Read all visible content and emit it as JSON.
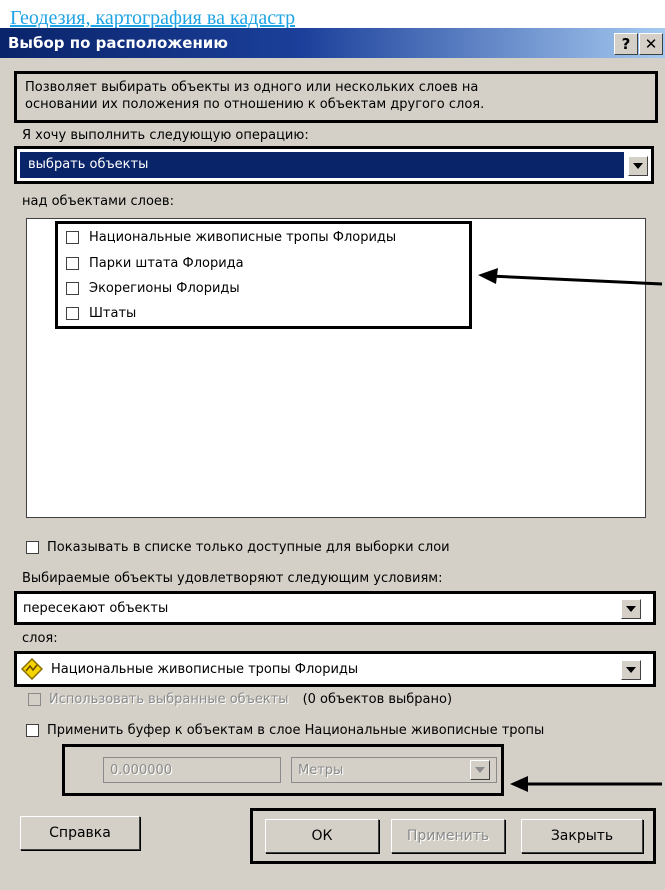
{
  "page_header": {
    "link_text": "Геодезия, картография ва кадастр"
  },
  "window": {
    "title": "Выбор по расположению",
    "help_glyph": "?",
    "close_glyph": "✕"
  },
  "description": {
    "line1": "Позволяет выбирать объекты из одного или нескольких слоев на",
    "line2": "основании их положения по отношению к объектам другого слоя."
  },
  "operation": {
    "label": "Я хочу выполнить следующую операцию:",
    "selected": "выбрать объекты"
  },
  "layers": {
    "label": "над объектами слоев:",
    "items": [
      {
        "label": "Национальные живописные тропы Флориды",
        "checked": false
      },
      {
        "label": "Парки штата Флорида",
        "checked": false
      },
      {
        "label": "Экорегионы Флориды",
        "checked": false
      },
      {
        "label": "Штаты",
        "checked": false
      }
    ]
  },
  "only_selectable": {
    "label": "Показывать в списке только доступные для выборки слои",
    "checked": false
  },
  "condition": {
    "label": "Выбираемые объекты удовлетворяют следующим условиям:",
    "selected": "пересекают объекты"
  },
  "source_layer": {
    "label": "слоя:",
    "selected": "Национальные живописные тропы Флориды",
    "icon": "layer-diamond-icon"
  },
  "use_selected": {
    "label": "Использовать выбранные объекты",
    "count_text": "(0 объектов выбрано)",
    "enabled": false
  },
  "buffer": {
    "label": "Применить буфер к объектам в слое Национальные живописные тропы",
    "checked": false,
    "distance": "0.000000",
    "units": "Метры"
  },
  "buttons": {
    "help": "Справка",
    "ok": "ОК",
    "apply": "Применить",
    "close": "Закрыть"
  },
  "colors": {
    "titlebar": "#0a246a",
    "selection": "#0a246a",
    "dialog_bg": "#d4d0c8",
    "header_link": "#1ea3e6"
  }
}
